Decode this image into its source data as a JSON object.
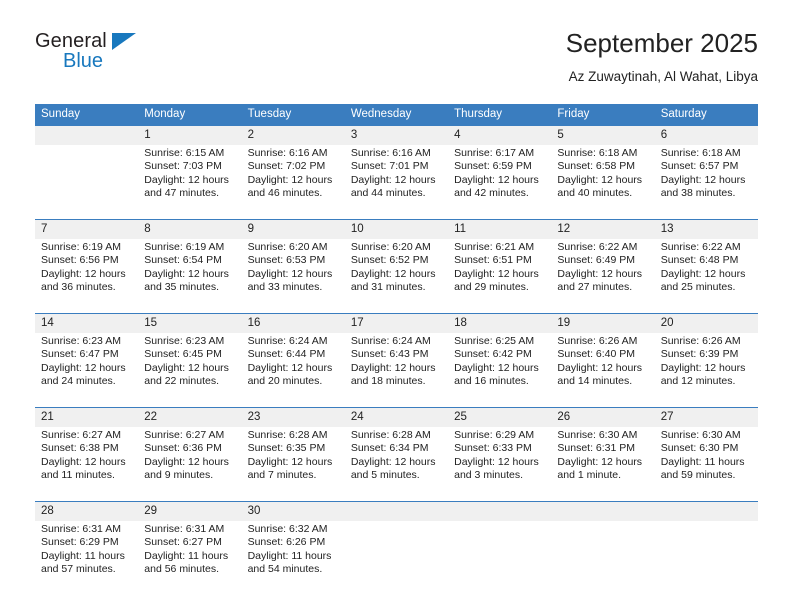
{
  "brand": {
    "name_top": "General",
    "name_bottom": "Blue",
    "accent_color": "#1878be"
  },
  "header": {
    "title": "September 2025",
    "subtitle": "Az Zuwaytinah, Al Wahat, Libya"
  },
  "calendar": {
    "header_bg": "#3a7dbf",
    "daynum_bg": "#f0f0f0",
    "weekday_headers": [
      "Sunday",
      "Monday",
      "Tuesday",
      "Wednesday",
      "Thursday",
      "Friday",
      "Saturday"
    ],
    "weeks": [
      [
        {
          "day": "",
          "sunrise": "",
          "sunset": "",
          "daylight_line1": "",
          "daylight_line2": ""
        },
        {
          "day": "1",
          "sunrise": "Sunrise: 6:15 AM",
          "sunset": "Sunset: 7:03 PM",
          "daylight_line1": "Daylight: 12 hours",
          "daylight_line2": "and 47 minutes."
        },
        {
          "day": "2",
          "sunrise": "Sunrise: 6:16 AM",
          "sunset": "Sunset: 7:02 PM",
          "daylight_line1": "Daylight: 12 hours",
          "daylight_line2": "and 46 minutes."
        },
        {
          "day": "3",
          "sunrise": "Sunrise: 6:16 AM",
          "sunset": "Sunset: 7:01 PM",
          "daylight_line1": "Daylight: 12 hours",
          "daylight_line2": "and 44 minutes."
        },
        {
          "day": "4",
          "sunrise": "Sunrise: 6:17 AM",
          "sunset": "Sunset: 6:59 PM",
          "daylight_line1": "Daylight: 12 hours",
          "daylight_line2": "and 42 minutes."
        },
        {
          "day": "5",
          "sunrise": "Sunrise: 6:18 AM",
          "sunset": "Sunset: 6:58 PM",
          "daylight_line1": "Daylight: 12 hours",
          "daylight_line2": "and 40 minutes."
        },
        {
          "day": "6",
          "sunrise": "Sunrise: 6:18 AM",
          "sunset": "Sunset: 6:57 PM",
          "daylight_line1": "Daylight: 12 hours",
          "daylight_line2": "and 38 minutes."
        }
      ],
      [
        {
          "day": "7",
          "sunrise": "Sunrise: 6:19 AM",
          "sunset": "Sunset: 6:56 PM",
          "daylight_line1": "Daylight: 12 hours",
          "daylight_line2": "and 36 minutes."
        },
        {
          "day": "8",
          "sunrise": "Sunrise: 6:19 AM",
          "sunset": "Sunset: 6:54 PM",
          "daylight_line1": "Daylight: 12 hours",
          "daylight_line2": "and 35 minutes."
        },
        {
          "day": "9",
          "sunrise": "Sunrise: 6:20 AM",
          "sunset": "Sunset: 6:53 PM",
          "daylight_line1": "Daylight: 12 hours",
          "daylight_line2": "and 33 minutes."
        },
        {
          "day": "10",
          "sunrise": "Sunrise: 6:20 AM",
          "sunset": "Sunset: 6:52 PM",
          "daylight_line1": "Daylight: 12 hours",
          "daylight_line2": "and 31 minutes."
        },
        {
          "day": "11",
          "sunrise": "Sunrise: 6:21 AM",
          "sunset": "Sunset: 6:51 PM",
          "daylight_line1": "Daylight: 12 hours",
          "daylight_line2": "and 29 minutes."
        },
        {
          "day": "12",
          "sunrise": "Sunrise: 6:22 AM",
          "sunset": "Sunset: 6:49 PM",
          "daylight_line1": "Daylight: 12 hours",
          "daylight_line2": "and 27 minutes."
        },
        {
          "day": "13",
          "sunrise": "Sunrise: 6:22 AM",
          "sunset": "Sunset: 6:48 PM",
          "daylight_line1": "Daylight: 12 hours",
          "daylight_line2": "and 25 minutes."
        }
      ],
      [
        {
          "day": "14",
          "sunrise": "Sunrise: 6:23 AM",
          "sunset": "Sunset: 6:47 PM",
          "daylight_line1": "Daylight: 12 hours",
          "daylight_line2": "and 24 minutes."
        },
        {
          "day": "15",
          "sunrise": "Sunrise: 6:23 AM",
          "sunset": "Sunset: 6:45 PM",
          "daylight_line1": "Daylight: 12 hours",
          "daylight_line2": "and 22 minutes."
        },
        {
          "day": "16",
          "sunrise": "Sunrise: 6:24 AM",
          "sunset": "Sunset: 6:44 PM",
          "daylight_line1": "Daylight: 12 hours",
          "daylight_line2": "and 20 minutes."
        },
        {
          "day": "17",
          "sunrise": "Sunrise: 6:24 AM",
          "sunset": "Sunset: 6:43 PM",
          "daylight_line1": "Daylight: 12 hours",
          "daylight_line2": "and 18 minutes."
        },
        {
          "day": "18",
          "sunrise": "Sunrise: 6:25 AM",
          "sunset": "Sunset: 6:42 PM",
          "daylight_line1": "Daylight: 12 hours",
          "daylight_line2": "and 16 minutes."
        },
        {
          "day": "19",
          "sunrise": "Sunrise: 6:26 AM",
          "sunset": "Sunset: 6:40 PM",
          "daylight_line1": "Daylight: 12 hours",
          "daylight_line2": "and 14 minutes."
        },
        {
          "day": "20",
          "sunrise": "Sunrise: 6:26 AM",
          "sunset": "Sunset: 6:39 PM",
          "daylight_line1": "Daylight: 12 hours",
          "daylight_line2": "and 12 minutes."
        }
      ],
      [
        {
          "day": "21",
          "sunrise": "Sunrise: 6:27 AM",
          "sunset": "Sunset: 6:38 PM",
          "daylight_line1": "Daylight: 12 hours",
          "daylight_line2": "and 11 minutes."
        },
        {
          "day": "22",
          "sunrise": "Sunrise: 6:27 AM",
          "sunset": "Sunset: 6:36 PM",
          "daylight_line1": "Daylight: 12 hours",
          "daylight_line2": "and 9 minutes."
        },
        {
          "day": "23",
          "sunrise": "Sunrise: 6:28 AM",
          "sunset": "Sunset: 6:35 PM",
          "daylight_line1": "Daylight: 12 hours",
          "daylight_line2": "and 7 minutes."
        },
        {
          "day": "24",
          "sunrise": "Sunrise: 6:28 AM",
          "sunset": "Sunset: 6:34 PM",
          "daylight_line1": "Daylight: 12 hours",
          "daylight_line2": "and 5 minutes."
        },
        {
          "day": "25",
          "sunrise": "Sunrise: 6:29 AM",
          "sunset": "Sunset: 6:33 PM",
          "daylight_line1": "Daylight: 12 hours",
          "daylight_line2": "and 3 minutes."
        },
        {
          "day": "26",
          "sunrise": "Sunrise: 6:30 AM",
          "sunset": "Sunset: 6:31 PM",
          "daylight_line1": "Daylight: 12 hours",
          "daylight_line2": "and 1 minute."
        },
        {
          "day": "27",
          "sunrise": "Sunrise: 6:30 AM",
          "sunset": "Sunset: 6:30 PM",
          "daylight_line1": "Daylight: 11 hours",
          "daylight_line2": "and 59 minutes."
        }
      ],
      [
        {
          "day": "28",
          "sunrise": "Sunrise: 6:31 AM",
          "sunset": "Sunset: 6:29 PM",
          "daylight_line1": "Daylight: 11 hours",
          "daylight_line2": "and 57 minutes."
        },
        {
          "day": "29",
          "sunrise": "Sunrise: 6:31 AM",
          "sunset": "Sunset: 6:27 PM",
          "daylight_line1": "Daylight: 11 hours",
          "daylight_line2": "and 56 minutes."
        },
        {
          "day": "30",
          "sunrise": "Sunrise: 6:32 AM",
          "sunset": "Sunset: 6:26 PM",
          "daylight_line1": "Daylight: 11 hours",
          "daylight_line2": "and 54 minutes."
        },
        {
          "day": "",
          "sunrise": "",
          "sunset": "",
          "daylight_line1": "",
          "daylight_line2": ""
        },
        {
          "day": "",
          "sunrise": "",
          "sunset": "",
          "daylight_line1": "",
          "daylight_line2": ""
        },
        {
          "day": "",
          "sunrise": "",
          "sunset": "",
          "daylight_line1": "",
          "daylight_line2": ""
        },
        {
          "day": "",
          "sunrise": "",
          "sunset": "",
          "daylight_line1": "",
          "daylight_line2": ""
        }
      ]
    ]
  }
}
